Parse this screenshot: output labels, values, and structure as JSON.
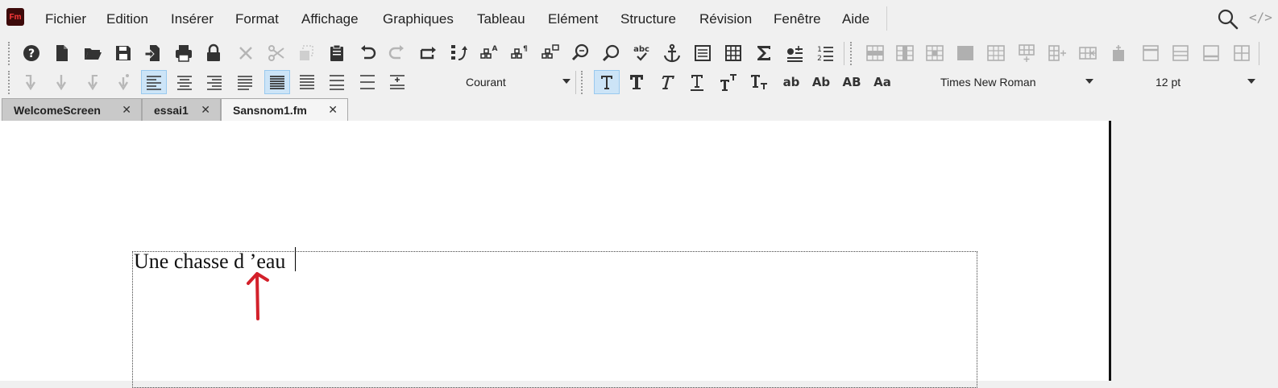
{
  "app": {
    "logo_text": "Fm"
  },
  "menu": [
    "Fichier",
    "Edition",
    "Insérer",
    "Format",
    "Affichage",
    "Graphiques",
    "Tableau",
    "Elément",
    "Structure",
    "Révision",
    "Fenêtre",
    "Aide"
  ],
  "toolbar": {
    "paragraph_format": "Courant",
    "font_family": "Times New Roman",
    "font_size": "12 pt",
    "lowercase_label": "ab",
    "capitalize_label": "Ab",
    "uppercase_label": "AB",
    "smallcaps_label": "Aa",
    "spellcheck_label": "abc"
  },
  "tabs": [
    {
      "label": "WelcomeScreen",
      "close": "✕"
    },
    {
      "label": "essai1",
      "close": "✕"
    },
    {
      "label": "Sansnom1.fm",
      "close": "✕"
    }
  ],
  "document": {
    "text": "Une chasse d ’eau"
  },
  "colors": {
    "annotation": "#d3202a",
    "active_button": "#cce4f7",
    "logo_bg": "#3d0a0a"
  }
}
